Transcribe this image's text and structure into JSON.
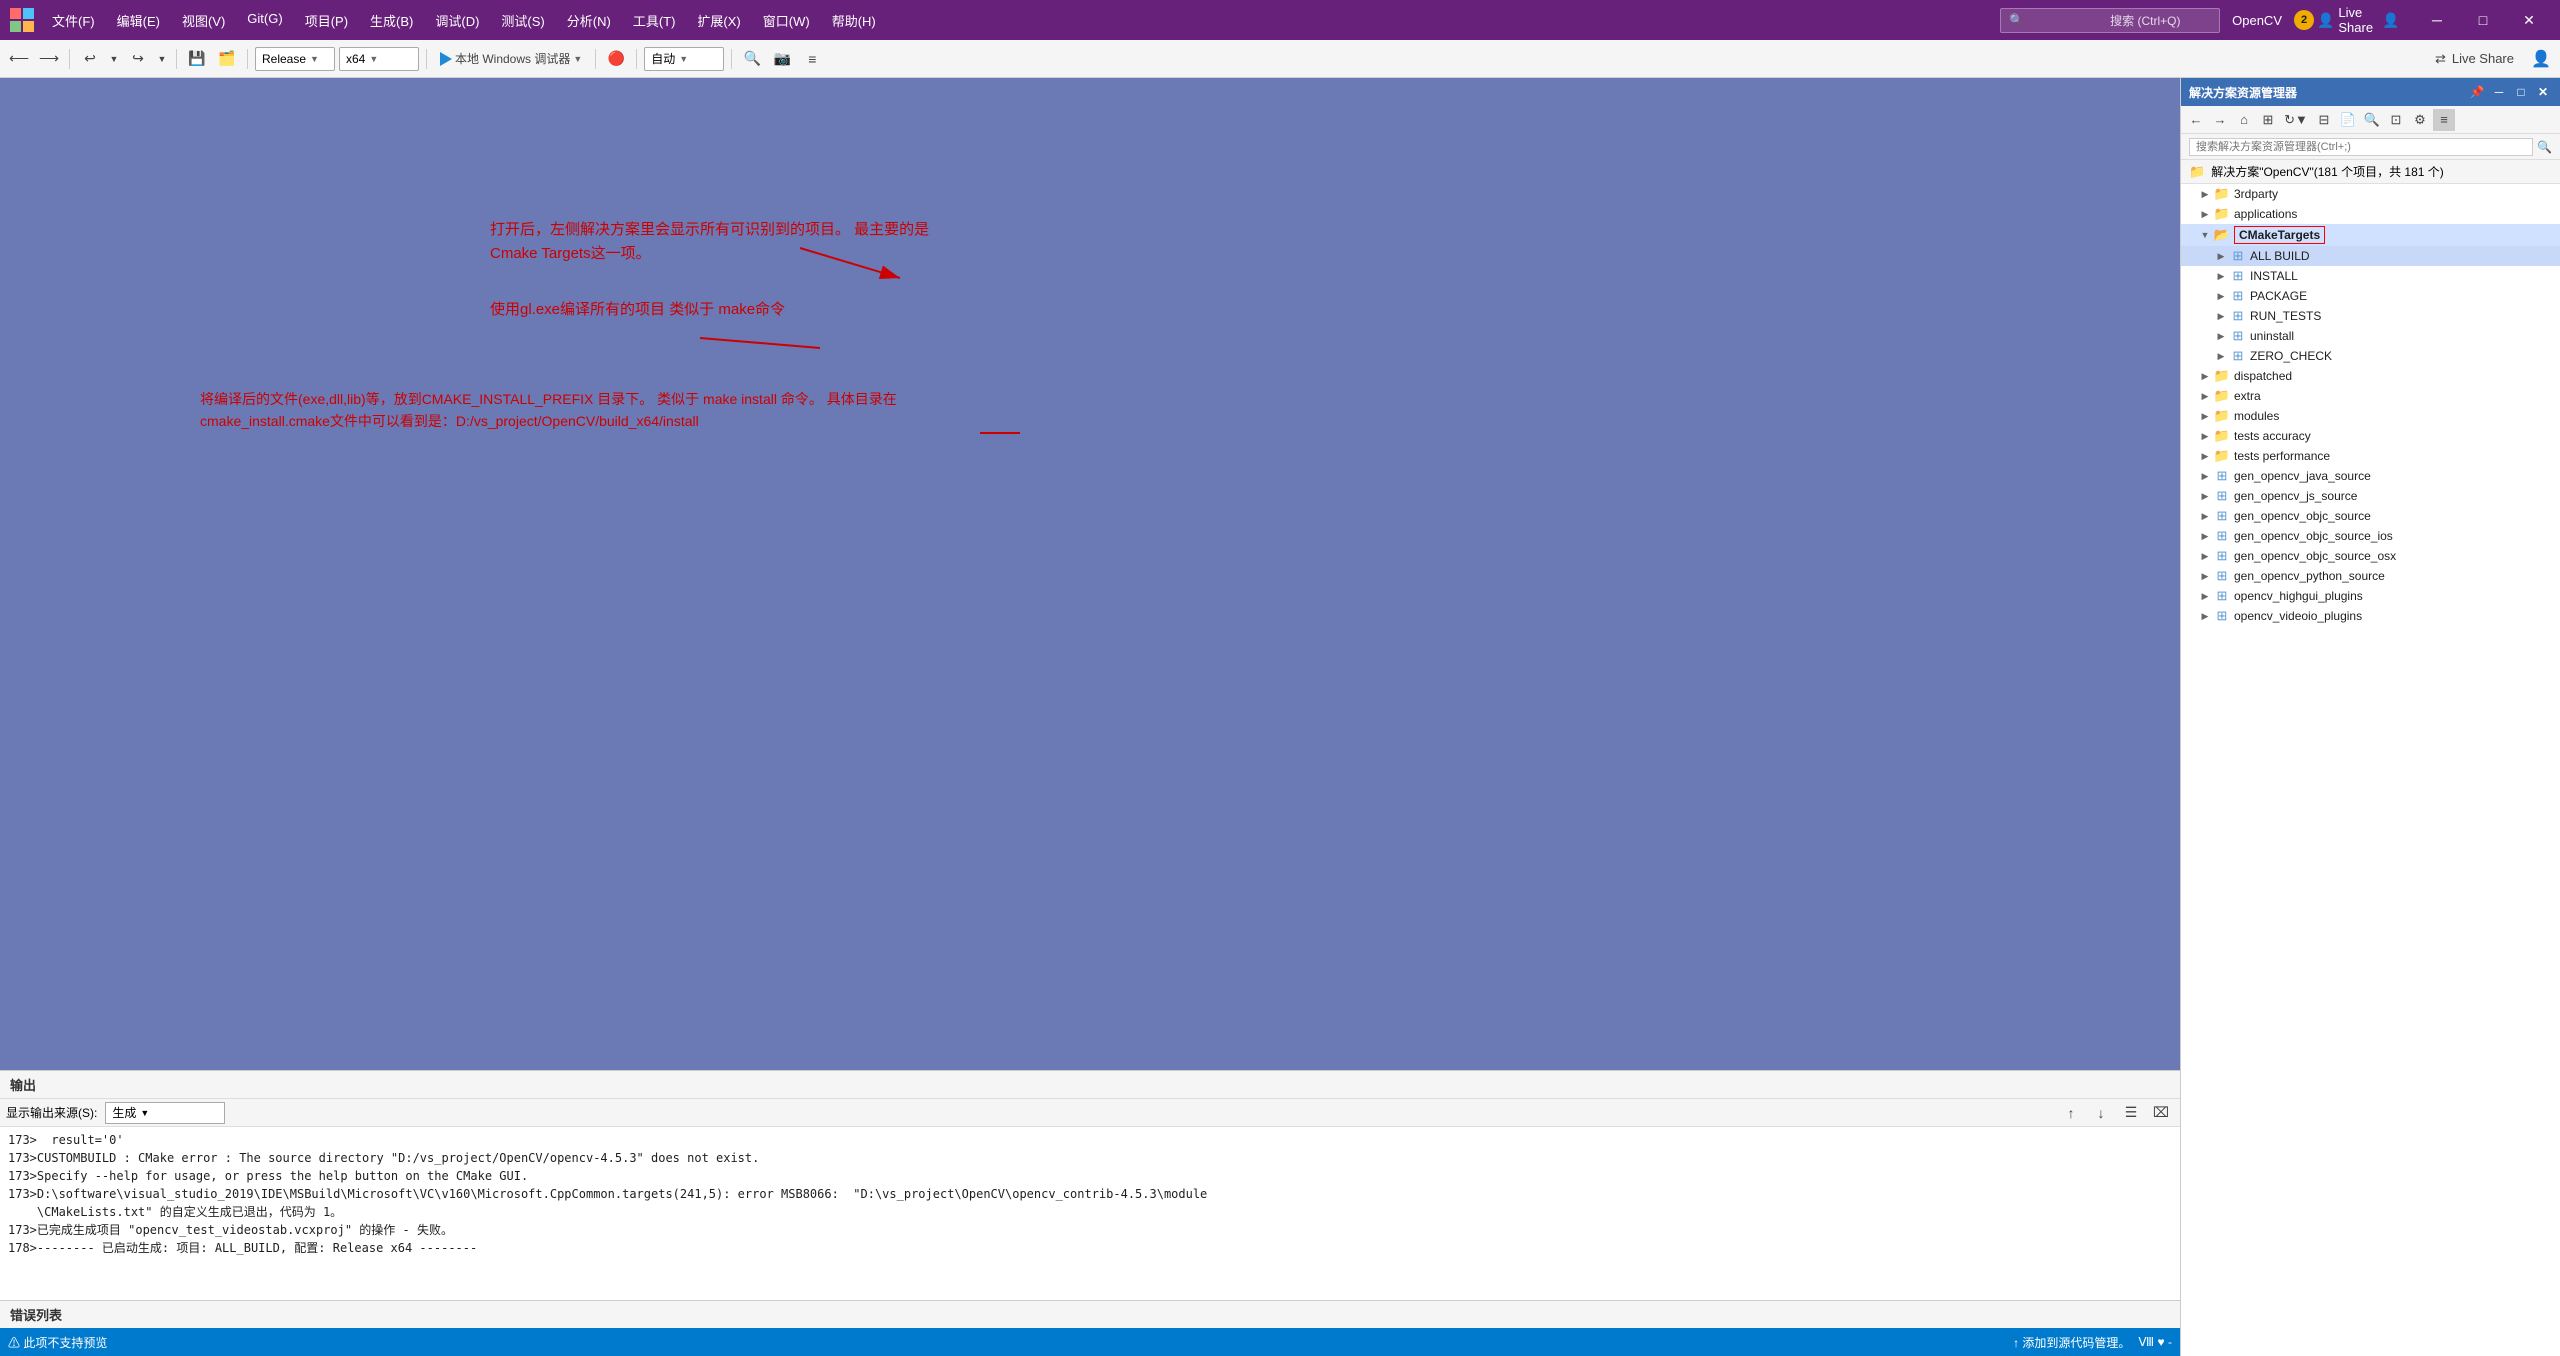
{
  "titleBar": {
    "logoText": "VS",
    "menus": [
      "文件(F)",
      "编辑(E)",
      "视图(V)",
      "Git(G)",
      "项目(P)",
      "生成(B)",
      "调试(D)",
      "测试(S)",
      "分析(N)",
      "工具(T)",
      "扩展(X)",
      "窗口(W)",
      "帮助(H)"
    ],
    "searchPlaceholder": "搜索 (Ctrl+Q)",
    "appName": "OpenCV",
    "badge": "2",
    "liveShare": "Live Share",
    "winMin": "─",
    "winMax": "□",
    "winClose": "✕"
  },
  "toolbar": {
    "buildConfig": "Release",
    "platform": "x64",
    "debugTarget": "本地 Windows 调试器",
    "autoLabel": "自动",
    "liveShareLabel": "Live Share"
  },
  "solutionExplorer": {
    "title": "解决方案资源管理器",
    "searchPlaceholder": "搜索解决方案资源管理器(Ctrl+;)",
    "solutionLabel": "解决方案\"OpenCV\"(181 个项目，共 181 个)",
    "tree": [
      {
        "id": "3rdparty",
        "level": 1,
        "type": "folder",
        "label": "3rdparty",
        "expanded": false
      },
      {
        "id": "applications",
        "level": 1,
        "type": "folder",
        "label": "applications",
        "expanded": false
      },
      {
        "id": "CMakeTargets",
        "level": 1,
        "type": "folder",
        "label": "CMakeTargets",
        "expanded": true,
        "selected": true
      },
      {
        "id": "ALL_BUILD",
        "level": 2,
        "type": "project",
        "label": "ALL BUILD",
        "expanded": false
      },
      {
        "id": "INSTALL",
        "level": 2,
        "type": "project",
        "label": "INSTALL",
        "expanded": false
      },
      {
        "id": "PACKAGE",
        "level": 2,
        "type": "project",
        "label": "PACKAGE",
        "expanded": false
      },
      {
        "id": "RUN_TESTS",
        "level": 2,
        "type": "project",
        "label": "RUN_TESTS",
        "expanded": false
      },
      {
        "id": "uninstall",
        "level": 2,
        "type": "project",
        "label": "uninstall",
        "expanded": false
      },
      {
        "id": "ZERO_CHECK",
        "level": 2,
        "type": "project",
        "label": "ZERO_CHECK",
        "expanded": false
      },
      {
        "id": "dispatched",
        "level": 1,
        "type": "folder",
        "label": "dispatched",
        "expanded": false
      },
      {
        "id": "extra",
        "level": 1,
        "type": "folder",
        "label": "extra",
        "expanded": false
      },
      {
        "id": "modules",
        "level": 1,
        "type": "folder",
        "label": "modules",
        "expanded": false
      },
      {
        "id": "tests_accuracy",
        "level": 1,
        "type": "folder",
        "label": "tests accuracy",
        "expanded": false
      },
      {
        "id": "tests_performance",
        "level": 1,
        "type": "folder",
        "label": "tests performance",
        "expanded": false
      },
      {
        "id": "gen_opencv_java_source",
        "level": 1,
        "type": "project2",
        "label": "gen_opencv_java_source",
        "expanded": false
      },
      {
        "id": "gen_opencv_js_source",
        "level": 1,
        "type": "project2",
        "label": "gen_opencv_js_source",
        "expanded": false
      },
      {
        "id": "gen_opencv_objc_source",
        "level": 1,
        "type": "project2",
        "label": "gen_opencv_objc_source",
        "expanded": false
      },
      {
        "id": "gen_opencv_objc_source_ios",
        "level": 1,
        "type": "project2",
        "label": "gen_opencv_objc_source_ios",
        "expanded": false
      },
      {
        "id": "gen_opencv_objc_source_osx",
        "level": 1,
        "type": "project2",
        "label": "gen_opencv_objc_source_osx",
        "expanded": false
      },
      {
        "id": "gen_opencv_python_source",
        "level": 1,
        "type": "project2",
        "label": "gen_opencv_python_source",
        "expanded": false
      },
      {
        "id": "opencv_highgui_plugins",
        "level": 1,
        "type": "project2",
        "label": "opencv_highgui_plugins",
        "expanded": false
      },
      {
        "id": "opencv_videoio_plugins",
        "level": 1,
        "type": "project2",
        "label": "opencv_videoio_plugins",
        "expanded": false
      }
    ]
  },
  "outputPanel": {
    "title": "输出",
    "sourceLabel": "显示输出来源(S):",
    "sourceValue": "生成",
    "lines": [
      "173>  result='0'",
      "173>CUSTOMBUILD : CMake error : The source directory \"D:/vs_project/OpenCV/opencv-4.5.3\" does not exist.",
      "173>Specify --help for usage, or press the help button on the CMake GUI.",
      "173>D:\\software\\visual_studio_2019\\IDE\\MSBuild\\Microsoft\\VC\\v160\\Microsoft.CppCommon.targets(241,5): error MSB8066:  \"D:\\vs_project\\OpenCV\\opencv_contrib-4.5.3\\module",
      "    \\CMakeLists.txt\" 的自定义生成已退出，代码为 1。",
      "173>已完成生成项目 \"opencv_test_videostab.vcxproj\" 的操作 - 失败。",
      "178>-------- 已启动生成: 项目: ALL_BUILD, 配置: Release x64 --------"
    ]
  },
  "errorList": {
    "title": "错误列表"
  },
  "statusBar": {
    "warning": "⚠ 此项不支持预览",
    "rightText": "↑ 添加到源代码管理。",
    "extraRight": "Ⅷ ♥ ‐"
  },
  "annotations": {
    "text1": "打开后，左侧解决方案里会显示所有可识别到的项目。\n最主要的是Cmake Targets这一项。",
    "text2": "使用gl.exe编译所有的项目\n类似于 make命令",
    "text3": "将编译后的文件(exe,dll,lib)等，放到CMAKE_INSTALL_PREFIX 目录下。\n类似于 make install 命令。\n具体目录在cmake_install.cmake文件中可以看到是：D:/vs_project/OpenCV/build_x64/install"
  },
  "colors": {
    "editorBg": "#6b7ab5",
    "annotationRed": "#cc0000",
    "selectedBg": "#3399ff",
    "titleBarBg": "#68217a",
    "seBg": "white"
  }
}
